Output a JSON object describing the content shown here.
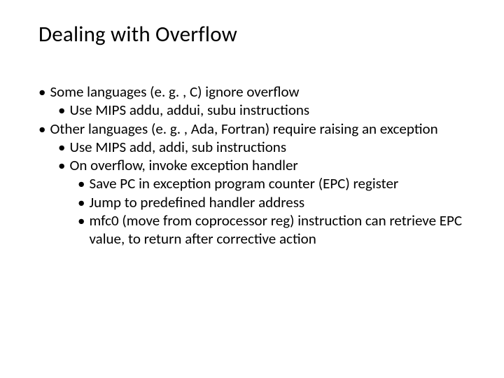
{
  "slide": {
    "title": "Dealing with Overflow",
    "bullets": {
      "b0": "Some languages (e. g. , C) ignore overflow",
      "b1": "Use MIPS addu, addui, subu instructions",
      "b2": "Other languages (e. g. , Ada, Fortran) require raising an exception",
      "b3": "Use MIPS add, addi, sub instructions",
      "b4": "On overflow, invoke exception handler",
      "b5": "Save PC in exception program counter (EPC) register",
      "b6": "Jump to predefined handler address",
      "b7": "mfc0 (move from coprocessor reg) instruction can retrieve EPC value, to return after corrective action"
    }
  }
}
